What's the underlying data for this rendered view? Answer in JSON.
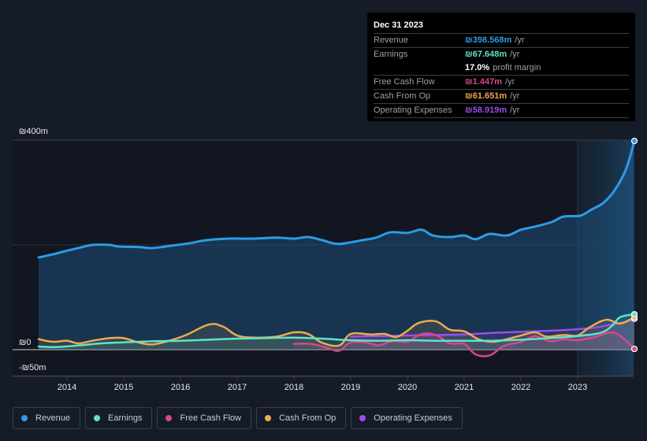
{
  "tooltip": {
    "date": "Dec 31 2023",
    "rows": [
      {
        "label": "Revenue",
        "value": "₪398.568m",
        "unit": "/yr",
        "color": "#2d9be8"
      },
      {
        "label": "Earnings",
        "value": "₪67.648m",
        "unit": "/yr",
        "color": "#5fe3c9"
      },
      {
        "label": "",
        "value": "17.0%",
        "unit": "profit margin",
        "color": "#ffffff"
      },
      {
        "label": "Free Cash Flow",
        "value": "₪1.447m",
        "unit": "/yr",
        "color": "#d6488a"
      },
      {
        "label": "Cash From Op",
        "value": "₪61.651m",
        "unit": "/yr",
        "color": "#f0a94f"
      },
      {
        "label": "Operating Expenses",
        "value": "₪58.919m",
        "unit": "/yr",
        "color": "#9d4ee8"
      }
    ]
  },
  "legend": [
    {
      "label": "Revenue",
      "color": "#2d9be8"
    },
    {
      "label": "Earnings",
      "color": "#5fe3c9"
    },
    {
      "label": "Free Cash Flow",
      "color": "#d6488a"
    },
    {
      "label": "Cash From Op",
      "color": "#f0a94f"
    },
    {
      "label": "Operating Expenses",
      "color": "#9d4ee8"
    }
  ],
  "chart_data": {
    "type": "area",
    "title": "",
    "xlabel": "",
    "ylabel": "",
    "currency": "₪",
    "y_ticks": [
      {
        "value": 400,
        "label": "₪400m"
      },
      {
        "value": 0,
        "label": "₪0"
      },
      {
        "value": -50,
        "label": "-₪50m"
      }
    ],
    "y_gridlines": [
      400,
      200,
      0,
      -50
    ],
    "ylim": [
      -50,
      400
    ],
    "xlim": [
      2013.5,
      2024.0
    ],
    "x_ticks": [
      2014,
      2015,
      2016,
      2017,
      2018,
      2019,
      2020,
      2021,
      2022,
      2023
    ],
    "x_tick_labels": [
      "2014",
      "2015",
      "2016",
      "2017",
      "2018",
      "2019",
      "2020",
      "2021",
      "2022",
      "2023"
    ],
    "highlight_range": [
      2023.0,
      2024.0
    ],
    "legend_position": "bottom-left",
    "series": [
      {
        "name": "Revenue",
        "color": "#2d9be8",
        "filled": true,
        "x": [
          2013.5,
          2013.75,
          2014.0,
          2014.2,
          2014.45,
          2014.75,
          2014.9,
          2015.25,
          2015.5,
          2015.8,
          2016.15,
          2016.45,
          2016.85,
          2017.25,
          2017.7,
          2018.0,
          2018.25,
          2018.5,
          2018.75,
          2019.0,
          2019.2,
          2019.45,
          2019.7,
          2020.0,
          2020.25,
          2020.45,
          2020.75,
          2021.0,
          2021.2,
          2021.45,
          2021.75,
          2022.0,
          2022.25,
          2022.55,
          2022.75,
          2023.05,
          2023.25,
          2023.45,
          2023.65,
          2023.85,
          2024.0
        ],
        "values": [
          176,
          182,
          189,
          194,
          200,
          200,
          197,
          196,
          194,
          198,
          203,
          209,
          212,
          212,
          214,
          212,
          215,
          209,
          202,
          205,
          209,
          214,
          224,
          223,
          229,
          218,
          215,
          218,
          211,
          221,
          218,
          229,
          235,
          244,
          254,
          256,
          268,
          280,
          304,
          344,
          398.6
        ]
      },
      {
        "name": "Earnings",
        "color": "#5fe3c9",
        "filled": true,
        "x": [
          2013.5,
          2013.8,
          2014.2,
          2014.6,
          2015.0,
          2015.5,
          2016.0,
          2016.5,
          2017.0,
          2017.5,
          2018.0,
          2018.5,
          2019.0,
          2019.5,
          2020.0,
          2020.5,
          2021.0,
          2021.5,
          2022.0,
          2022.5,
          2023.0,
          2023.4,
          2023.6,
          2023.75,
          2024.0
        ],
        "values": [
          6,
          5,
          8,
          12,
          14,
          16,
          17,
          19,
          21,
          22,
          23,
          21,
          18,
          17,
          18,
          17,
          17,
          17,
          19,
          22,
          26,
          32,
          45,
          62,
          67.6
        ]
      },
      {
        "name": "Free Cash Flow",
        "color": "#d6488a",
        "filled": true,
        "x": [
          2018.0,
          2018.3,
          2018.6,
          2018.8,
          2019.0,
          2019.3,
          2019.5,
          2019.75,
          2020.0,
          2020.25,
          2020.5,
          2020.75,
          2021.0,
          2021.2,
          2021.45,
          2021.7,
          2022.0,
          2022.25,
          2022.5,
          2022.75,
          2023.0,
          2023.3,
          2023.6,
          2023.8,
          2024.0
        ],
        "values": [
          11,
          11,
          3,
          -2,
          14,
          13,
          8,
          17,
          15,
          30,
          28,
          12,
          11,
          -9,
          -11,
          7,
          15,
          26,
          16,
          20,
          18,
          24,
          33,
          22,
          1.4
        ]
      },
      {
        "name": "Cash From Op",
        "color": "#f0a94f",
        "filled": true,
        "x": [
          2013.5,
          2013.75,
          2014.0,
          2014.2,
          2014.45,
          2014.75,
          2015.0,
          2015.25,
          2015.5,
          2015.8,
          2016.1,
          2016.5,
          2016.75,
          2017.0,
          2017.3,
          2017.7,
          2018.0,
          2018.25,
          2018.5,
          2018.8,
          2019.0,
          2019.35,
          2019.6,
          2019.8,
          2020.0,
          2020.2,
          2020.5,
          2020.75,
          2021.0,
          2021.25,
          2021.5,
          2021.75,
          2022.0,
          2022.25,
          2022.45,
          2022.75,
          2023.0,
          2023.2,
          2023.5,
          2023.75,
          2024.0
        ],
        "values": [
          20,
          15,
          17,
          12,
          17,
          22,
          22,
          14,
          10,
          17,
          28,
          48,
          44,
          27,
          23,
          25,
          33,
          30,
          13,
          8,
          30,
          29,
          30,
          24,
          36,
          51,
          54,
          38,
          35,
          20,
          15,
          20,
          27,
          33,
          25,
          28,
          27,
          42,
          57,
          50,
          61.7
        ]
      },
      {
        "name": "Operating Expenses",
        "color": "#9d4ee8",
        "filled": true,
        "x": [
          2019.0,
          2019.5,
          2020.0,
          2020.5,
          2021.0,
          2021.5,
          2022.0,
          2022.5,
          2023.0,
          2023.3,
          2023.6,
          2023.85,
          2024.0
        ],
        "values": [
          25,
          26,
          27,
          28,
          29,
          32,
          34,
          36,
          39,
          42,
          48,
          53,
          58.9
        ]
      }
    ]
  }
}
